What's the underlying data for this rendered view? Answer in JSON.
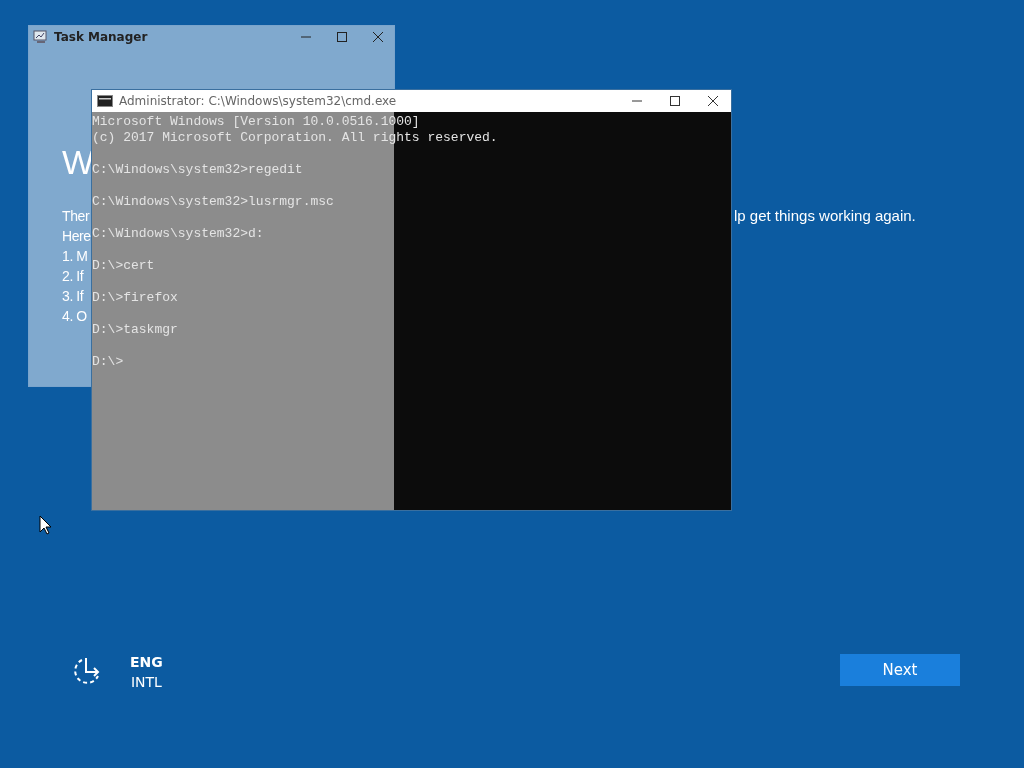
{
  "background": {
    "heading": "W",
    "lines": [
      "Ther",
      "Here",
      "1. M",
      "2. If",
      "3. If",
      "4. O"
    ],
    "right_text": "lp get things working again."
  },
  "cmd_window": {
    "title": "Administrator: C:\\Windows\\system32\\cmd.exe",
    "lines": [
      {
        "kind": "output",
        "text": "Microsoft Windows [Version 10.0.0516.1000]"
      },
      {
        "kind": "output",
        "text": "(c) 2017 Microsoft Corporation. All rights reserved."
      },
      {
        "kind": "prompt",
        "text": "C:\\Windows\\system32>regedit"
      },
      {
        "kind": "prompt",
        "text": "C:\\Windows\\system32>lusrmgr.msc"
      },
      {
        "kind": "prompt",
        "text": "C:\\Windows\\system32>d:"
      },
      {
        "kind": "prompt",
        "text": "D:\\>cert"
      },
      {
        "kind": "prompt",
        "text": "D:\\>firefox"
      },
      {
        "kind": "prompt",
        "text": "D:\\>taskmgr"
      },
      {
        "kind": "prompt",
        "text": "D:\\>"
      }
    ]
  },
  "task_manager": {
    "title": "Task Manager"
  },
  "language": {
    "code": "ENG",
    "layout": "INTL"
  },
  "next_button": "Next"
}
